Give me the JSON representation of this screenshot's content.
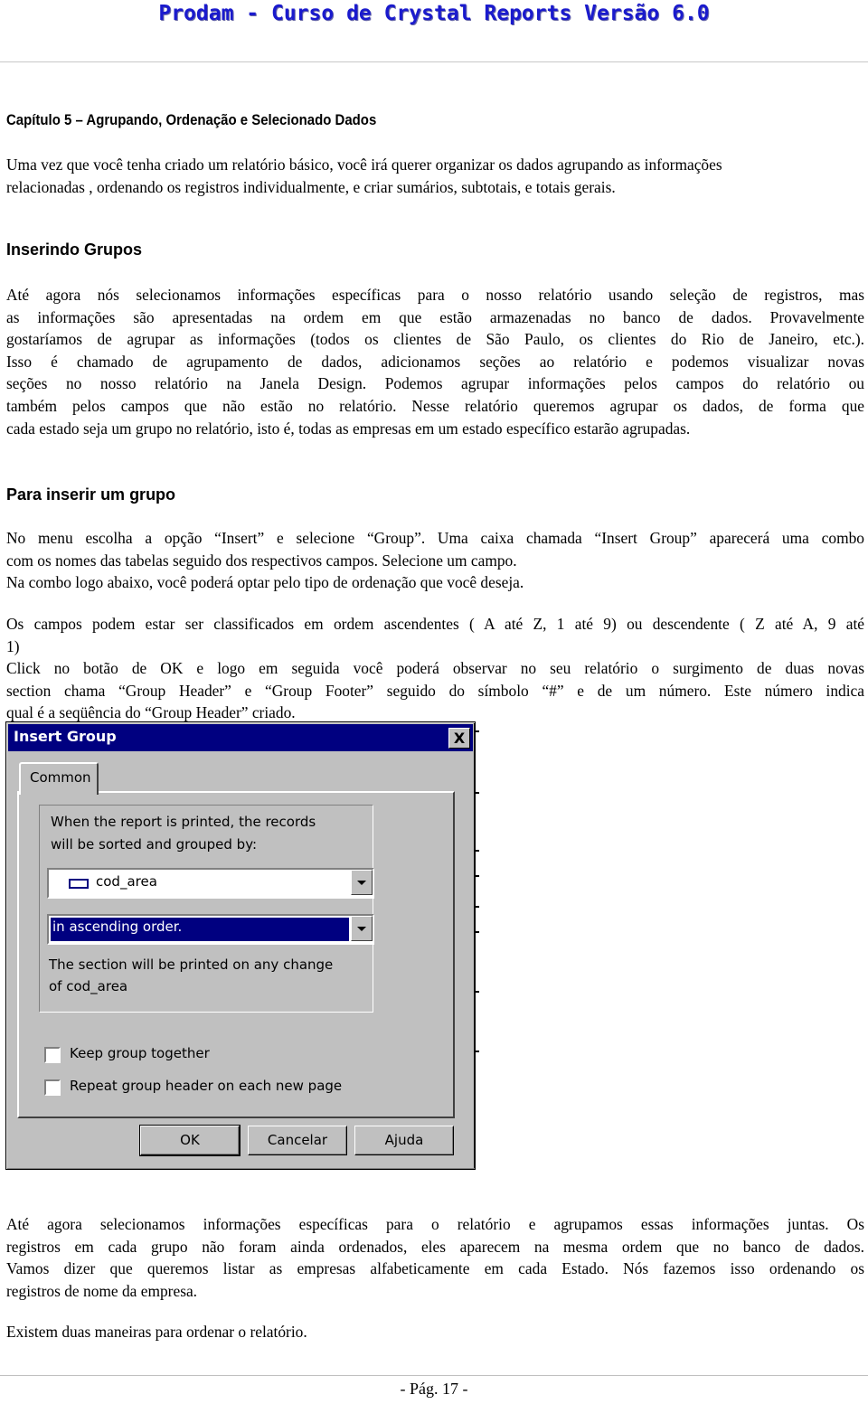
{
  "header": {
    "title": "Prodam  -  Curso de Crystal Reports Versão 6.0",
    "color": "#1a1acd"
  },
  "chapter_title": "Capítulo 5 – Agrupando, Ordenação e Selecionado Dados",
  "intro": [
    "Uma vez que você tenha criado um relatório básico, você irá querer organizar os dados agrupando as informações",
    "relacionadas , ordenando os registros individualmente, e criar sumários, subtotais, e totais gerais."
  ],
  "section1": {
    "heading": "Inserindo Grupos",
    "lines": [
      "Até agora nós selecionamos informações específicas para o nosso relatório usando seleção de registros, mas",
      "as informações são apresentadas na ordem em que estão armazenadas no banco de dados. Provavelmente",
      "gostaríamos de agrupar as informações (todos os clientes de São Paulo, os clientes do Rio de Janeiro, etc.).",
      "Isso é chamado de agrupamento de dados, adicionamos seções ao relatório e podemos visualizar novas",
      "seções no nosso relatório na Janela Design. Podemos agrupar informações pelos campos do relatório ou",
      "também pelos campos que não estão no relatório. Nesse relatório queremos agrupar os dados, de forma que",
      "cada estado seja um grupo no relatório, isto é, todas as empresas em um estado específico estarão agrupadas."
    ]
  },
  "section2": {
    "heading": "Para inserir um grupo",
    "lines_a": [
      "No menu escolha a opção “Insert” e selecione “Group”. Uma caixa chamada “Insert Group” aparecerá uma combo",
      "com os nomes das tabelas seguido dos respectivos campos. Selecione um campo.",
      "Na combo logo abaixo, você poderá optar pelo tipo de ordenação que você deseja."
    ],
    "lines_b": [
      "Os campos podem estar ser classificados em ordem ascendentes ( A até Z, 1 até 9) ou descendente ( Z até A, 9 até",
      "1)",
      "Click no botão de OK e logo em seguida você poderá observar no seu relatório o surgimento de duas novas",
      "section chama “Group Header”  e “Group Footer” seguido do símbolo “#” e de um número. Este número indica",
      "qual é a seqüência do “Group Header” criado."
    ]
  },
  "dialog": {
    "title": "Insert Group",
    "close_label": "X",
    "tab_label": "Common",
    "sorted_text_1": "When the report is printed, the records",
    "sorted_text_2": "will be sorted and grouped by:",
    "field_combo_value": "cod_area",
    "field_icon": "database-field-icon",
    "order_combo_value": "in ascending order.",
    "section_text_1": "The section will be printed on any change",
    "section_text_2": "of  cod_area",
    "keep_together_label": "Keep group together",
    "keep_together_checked": false,
    "repeat_header_label": "Repeat group header on each new page",
    "repeat_header_checked": false,
    "ok_label": "OK",
    "cancel_label": "Cancelar",
    "help_label": "Ajuda",
    "titlebar_color": "#000080",
    "face_color": "#c0c0c0"
  },
  "closing": {
    "lines": [
      "Até agora selecionamos informações específicas para o relatório e agrupamos essas informações juntas. Os",
      "registros em cada grupo não foram ainda ordenados, eles aparecem na mesma ordem que no banco de dados.",
      "Vamos dizer que queremos listar as empresas alfabeticamente em cada Estado. Nós fazemos isso ordenando os",
      "registros de nome da empresa."
    ],
    "last": "Existem duas maneiras para ordenar o relatório."
  },
  "footer": {
    "page": "- Pág. 17 -"
  }
}
